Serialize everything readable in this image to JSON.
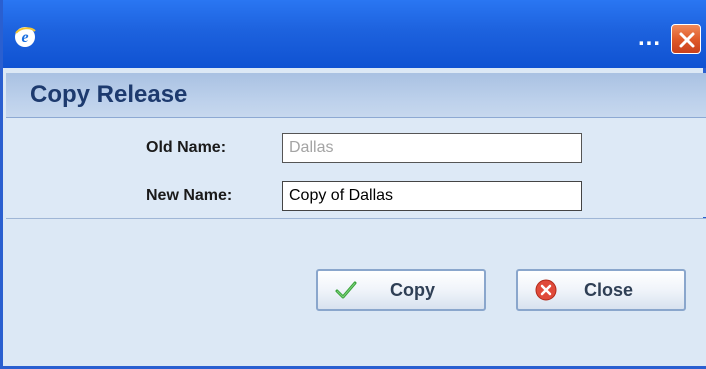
{
  "window": {
    "title_dots": "...",
    "icons": {
      "app": "ie-icon",
      "close": "close-icon"
    },
    "colors": {
      "titlebar": "#1d62de",
      "close": "#e05b2a",
      "panel": "#dce8f5"
    }
  },
  "dialog": {
    "title": "Copy Release",
    "old_name_label": "Old Name:",
    "old_name_value": "Dallas",
    "new_name_label": "New Name:",
    "new_name_value": "Copy of Dallas",
    "buttons": {
      "copy": {
        "label": "Copy",
        "icon": "check-icon"
      },
      "close": {
        "label": "Close",
        "icon": "close-circle-icon"
      }
    }
  }
}
